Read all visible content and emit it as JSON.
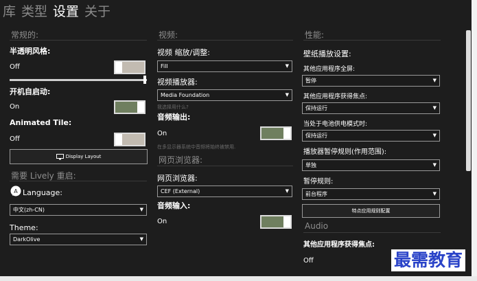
{
  "tabs": [
    "库",
    "类型",
    "设置",
    "关于"
  ],
  "col1": {
    "section_general": "常规的:",
    "semi_transparent": {
      "label": "半透明风格:",
      "value": "Off",
      "state": "off"
    },
    "slider_level": 0.98,
    "autostart": {
      "label": "开机自启动:",
      "value": "On",
      "state": "on"
    },
    "animated_tile": {
      "label": "Animated Tile:",
      "value": "Off",
      "state": "off"
    },
    "display_layout_button": "Display Layout",
    "section_restart": "需要 Lively 重启:",
    "language": {
      "label": "Language:",
      "selected": "中文(zh-CN)"
    },
    "theme": {
      "label": "Theme:",
      "selected": "DarkOlive"
    }
  },
  "col2": {
    "section_video": "视频:",
    "video_scaling": {
      "label": "视频 缩放/调整:",
      "selected": "Fill"
    },
    "video_player": {
      "label": "视频播放器:",
      "selected": "Media Foundation"
    },
    "player_hint": "我选择用什么?",
    "audio_output": {
      "label": "音频输出:",
      "value": "On",
      "state": "on"
    },
    "audio_hint": "在多显示器系统中音频将始终被禁用.",
    "section_browser": "网页浏览器:",
    "web_browser": {
      "label": "网页浏览器:",
      "selected": "CEF (External)"
    },
    "audio_input": {
      "label": "音频输入:",
      "value": "On",
      "state": "on"
    }
  },
  "col3": {
    "section_performance": "性能:",
    "wallpaper_playback": "壁纸播放设置:",
    "other_fullscreen": {
      "label": "其他应用程序全屏:",
      "selected": "暂停"
    },
    "other_focus": {
      "label": "其他应用程序获得焦点:",
      "selected": "保持运行"
    },
    "battery_mode": {
      "label": "当处于电池供电模式时:",
      "selected": "保持运行"
    },
    "pause_rule": {
      "label": "播放器暂停规则(作用范围):",
      "selected": "单独"
    },
    "pause_rules": {
      "label": "暂停规则:",
      "selected": "前台程序"
    },
    "app_rules_button": "特点应用规则配置",
    "section_audio": "Audio",
    "audio_focus": {
      "label": "其他应用程序获得焦点:",
      "value": "Off"
    }
  },
  "watermark": "最需教育",
  "colors": {
    "background": "#1d1d1d",
    "toggle_on": "#6f7f5f",
    "toggle_off": "#c2bbb1",
    "watermark": "#2a43c8"
  }
}
